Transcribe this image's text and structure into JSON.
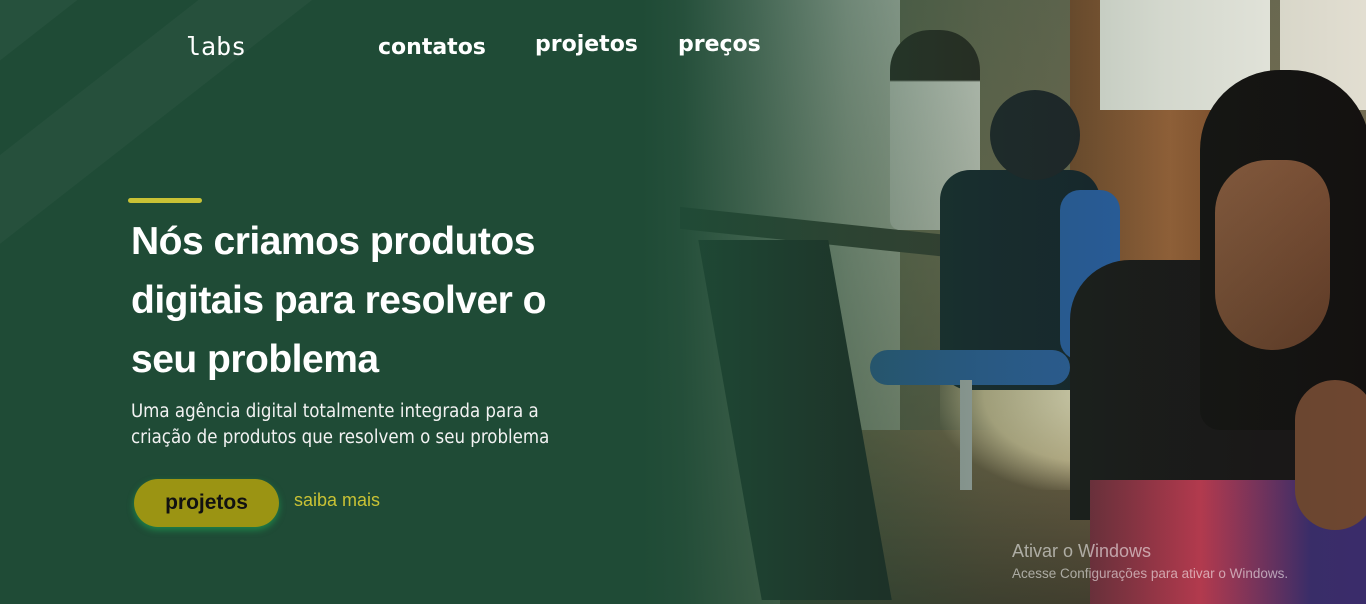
{
  "brand": {
    "logo": "labs"
  },
  "nav": {
    "items": [
      {
        "label": "contatos"
      },
      {
        "label": "projetos"
      },
      {
        "label": "preços"
      }
    ]
  },
  "hero": {
    "headline": "Nós criamos produtos digitais para resolver o seu problema",
    "subtitle_line1": "Uma agência digital totalmente integrada para a",
    "subtitle_line2": "criação de produtos que resolvem o seu problema",
    "primary_button": "projetos",
    "secondary_link": "saiba mais"
  },
  "os_watermark": {
    "title": "Ativar o Windows",
    "subtitle": "Acesse Configurações para ativar o Windows."
  },
  "colors": {
    "background": "#1f4b36",
    "accent": "#c9c235",
    "button": "#9b9413"
  }
}
